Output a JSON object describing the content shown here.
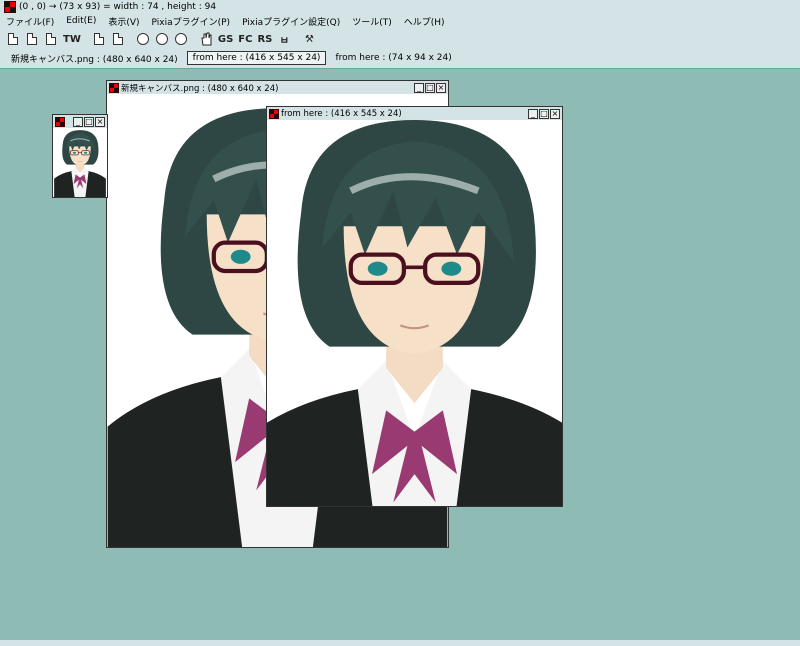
{
  "titlebar": {
    "title": "(0 , 0) → (73 x 93) = width : 74 , height : 94"
  },
  "menu": [
    {
      "label": "ファイル(F)"
    },
    {
      "label": "Edit(E)"
    },
    {
      "label": "表示(V)"
    },
    {
      "label": "Pixiaプラグイン(P)"
    },
    {
      "label": "Pixiaプラグイン設定(Q)"
    },
    {
      "label": "ツール(T)"
    },
    {
      "label": "ヘルプ(H)"
    }
  ],
  "toolbar": {
    "tw": "TW",
    "gs": "GS",
    "fc": "FC",
    "rs": "RS",
    "crop": "ㅂ",
    "tools": "⚒"
  },
  "tabs": [
    {
      "label": "新規キャンバス.png : (480 x 640 x 24)"
    },
    {
      "label": "from here : (416 x 545 x 24)"
    },
    {
      "label": "from here : (74 x 94 x 24)"
    }
  ],
  "windows": {
    "main": {
      "title": "新規キャンバス.png : (480 x 640 x 24)"
    },
    "crop": {
      "title": "from here : (416 x 545 x 24)"
    },
    "thumb": {
      "title": ""
    }
  },
  "colors": {
    "desktop": "#8ebcb5",
    "chrome": "#d4e4e6",
    "hair": "#2f4744",
    "jacket": "#1f2422",
    "tie": "#9a3a72"
  }
}
